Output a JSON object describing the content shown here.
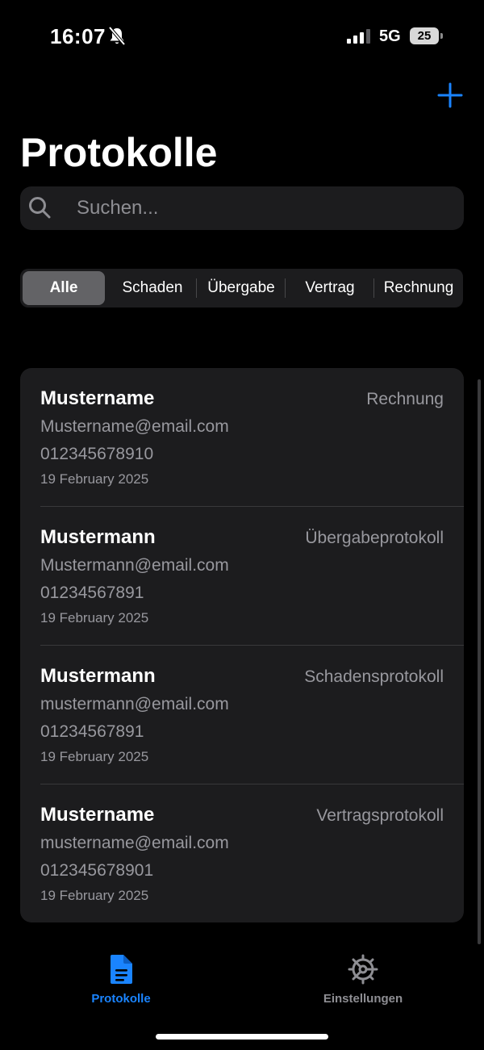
{
  "status_bar": {
    "time": "16:07",
    "network": "5G",
    "battery": "25"
  },
  "header": {
    "title": "Protokolle"
  },
  "search": {
    "placeholder": "Suchen..."
  },
  "filters": [
    "Alle",
    "Schaden",
    "Übergabe",
    "Vertrag",
    "Rechnung"
  ],
  "selected_filter": "Alle",
  "protocols": [
    {
      "name": "Mustername",
      "type": "Rechnung",
      "email": "Mustername@email.com",
      "phone": "012345678910",
      "date": "19 February 2025"
    },
    {
      "name": "Mustermann",
      "type": "Übergabeprotokoll",
      "email": "Mustermann@email.com",
      "phone": "01234567891",
      "date": "19 February 2025"
    },
    {
      "name": "Mustermann",
      "type": "Schadensprotokoll",
      "email": "mustermann@email.com",
      "phone": "01234567891",
      "date": "19 February 2025"
    },
    {
      "name": "Mustername",
      "type": "Vertragsprotokoll",
      "email": "mustername@email.com",
      "phone": "012345678901",
      "date": "19 February 2025"
    }
  ],
  "tab_bar": {
    "tabs": [
      {
        "label": "Protokolle",
        "icon": "document-icon",
        "active": true
      },
      {
        "label": "Einstellungen",
        "icon": "gear-icon",
        "active": false
      }
    ]
  },
  "colors": {
    "accent": "#1a84ff",
    "background": "#000000",
    "card": "#1c1c1e",
    "secondary_text": "#98989e",
    "inactive_tab": "#8e8e93"
  }
}
